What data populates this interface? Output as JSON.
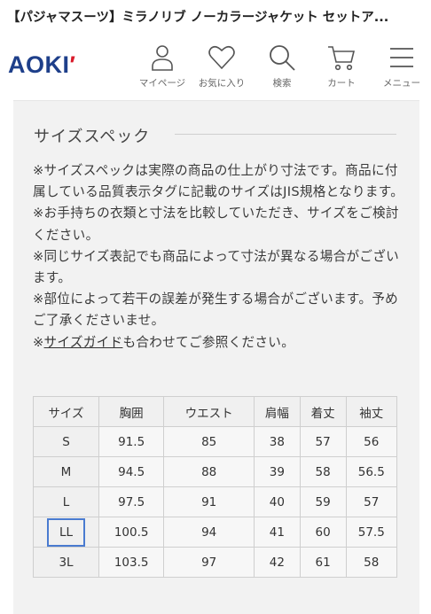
{
  "page_title": "【パジャマスーツ】ミラノリブ ノーカラージャケット セットア...",
  "brand": {
    "name": "AOKI",
    "mark": "′"
  },
  "nav": [
    {
      "label": "マイページ",
      "icon": "person-icon"
    },
    {
      "label": "お気に入り",
      "icon": "heart-icon"
    },
    {
      "label": "検索",
      "icon": "search-icon"
    },
    {
      "label": "カート",
      "icon": "cart-icon"
    },
    {
      "label": "メニュー",
      "icon": "menu-icon"
    }
  ],
  "section": {
    "title": "サイズスペック",
    "notes": [
      "※サイズスペックは実際の商品の仕上がり寸法です。商品に付属している品質表示タグに記載のサイズはJIS規格となります。",
      "※お手持ちの衣類と寸法を比較していただき、サイズをご検討ください。",
      "※同じサイズ表記でも商品によって寸法が異なる場合がございます。",
      "※部位によって若干の誤差が発生する場合がございます。予めご了承くださいませ。"
    ],
    "guide_prefix": "※",
    "guide_link": "サイズガイド",
    "guide_suffix": "も合わせてご参照ください。"
  },
  "table": {
    "headers": [
      "サイズ",
      "胸囲",
      "ウエスト",
      "肩幅",
      "着丈",
      "袖丈"
    ],
    "rows": [
      [
        "S",
        "91.5",
        "85",
        "38",
        "57",
        "56"
      ],
      [
        "M",
        "94.5",
        "88",
        "39",
        "58",
        "56.5"
      ],
      [
        "L",
        "97.5",
        "91",
        "40",
        "59",
        "57"
      ],
      [
        "LL",
        "100.5",
        "94",
        "41",
        "60",
        "57.5"
      ],
      [
        "3L",
        "103.5",
        "97",
        "42",
        "61",
        "58"
      ]
    ],
    "selected_row": 3
  },
  "colors": {
    "brand_blue": "#1e3f8a",
    "brand_red": "#d91a2a",
    "highlight": "#4a7bd0"
  }
}
